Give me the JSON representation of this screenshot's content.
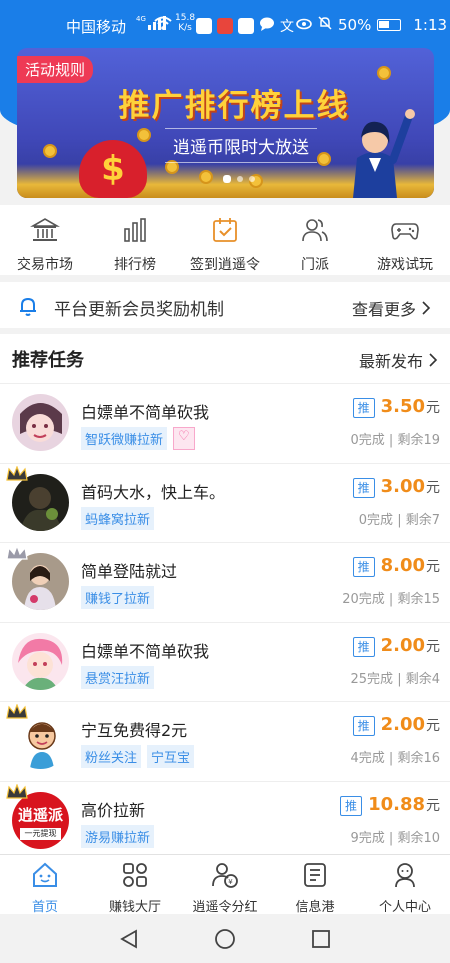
{
  "status_bar": {
    "carrier": "中国移动",
    "signal_type": "4G",
    "net_speed": "15.8",
    "net_unit": "K/s",
    "battery": "50%",
    "time": "1:13"
  },
  "banner": {
    "tag": "活动规则",
    "headline": "推广排行榜上线",
    "subtitle": "逍遥币限时大放送",
    "colors": {
      "bg": "#4a55c8",
      "headline": "#ffd23a"
    }
  },
  "quick_nav": [
    {
      "label": "交易市场",
      "icon": "bank-icon"
    },
    {
      "label": "排行榜",
      "icon": "bar-chart-icon"
    },
    {
      "label": "签到逍遥令",
      "icon": "calendar-check-icon"
    },
    {
      "label": "门派",
      "icon": "users-icon"
    },
    {
      "label": "游戏试玩",
      "icon": "gamepad-icon"
    }
  ],
  "notice": {
    "text": "平台更新会员奖励机制",
    "more": "查看更多"
  },
  "section": {
    "title": "推荐任务",
    "latest": "最新发布"
  },
  "tasks": [
    {
      "name": "白嫖单不简单砍我",
      "tags": [
        "智跃微赚拉新"
      ],
      "heart": true,
      "badge": "推",
      "amount": "3.50",
      "unit": "元",
      "done": "0完成",
      "left": "剩余19"
    },
    {
      "name": "首码大水，快上车。",
      "tags": [
        "蚂蜂窝拉新"
      ],
      "badge": "推",
      "amount": "3.00",
      "unit": "元",
      "done": "0完成",
      "left": "剩余7"
    },
    {
      "name": "简单登陆就过",
      "tags": [
        "赚钱了拉新"
      ],
      "badge": "推",
      "amount": "8.00",
      "unit": "元",
      "done": "20完成",
      "left": "剩余15"
    },
    {
      "name": "白嫖单不简单砍我",
      "tags": [
        "悬赏汪拉新"
      ],
      "badge": "推",
      "amount": "2.00",
      "unit": "元",
      "done": "25完成",
      "left": "剩余4"
    },
    {
      "name": "宁互免费得2元",
      "tags": [
        "粉丝关注",
        "宁互宝"
      ],
      "badge": "推",
      "amount": "2.00",
      "unit": "元",
      "done": "4完成",
      "left": "剩余16"
    },
    {
      "name": "高价拉新",
      "tags": [
        "游易赚拉新"
      ],
      "badge": "推",
      "amount": "10.88",
      "unit": "元",
      "done": "9完成",
      "left": "剩余10",
      "avatar_text": "逍遥派",
      "avatar_sub": "一元提现"
    }
  ],
  "tab_bar": [
    {
      "label": "首页",
      "icon": "home-icon",
      "active": true
    },
    {
      "label": "赚钱大厅",
      "icon": "grid-icon"
    },
    {
      "label": "逍遥令分红",
      "icon": "dividend-icon"
    },
    {
      "label": "信息港",
      "icon": "news-icon"
    },
    {
      "label": "个人中心",
      "icon": "profile-icon"
    }
  ],
  "accent_color": "#3a8ee6",
  "price_color": "#f08c1a"
}
